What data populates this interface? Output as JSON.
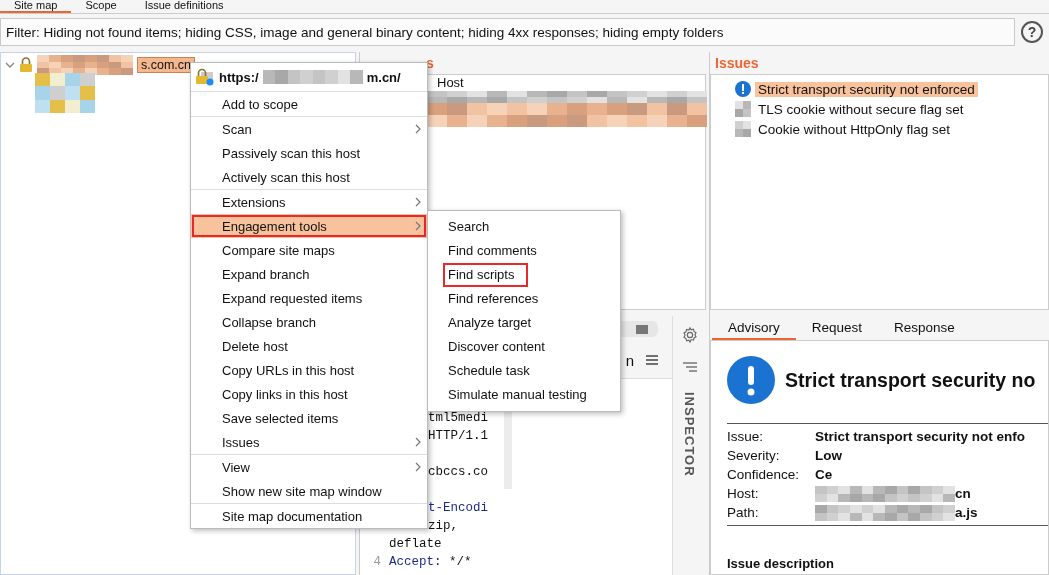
{
  "tabs": [
    {
      "label": "Site map",
      "selected": true
    },
    {
      "label": "Scope",
      "selected": false
    },
    {
      "label": "Issue definitions",
      "selected": false
    }
  ],
  "filter": {
    "text": "Filter: Hiding not found items;  hiding CSS, image and general binary content;  hiding 4xx responses;  hiding empty folders",
    "help": "?"
  },
  "tree": {
    "items": [
      {
        "label": "s.com.cn",
        "selected": true,
        "expanded": true
      }
    ]
  },
  "contents": {
    "title": "s",
    "columns": [
      "Host"
    ]
  },
  "issues": {
    "title": "Issues",
    "items": [
      {
        "label": "Strict transport security not enforced",
        "selected": true
      },
      {
        "label": "TLS cookie without secure flag set",
        "selected": false
      },
      {
        "label": "Cookie without HttpOnly flag set",
        "selected": false
      }
    ]
  },
  "request": {
    "toggle_on": true,
    "fragment": "n",
    "inspector": "INSPECTOR",
    "lines": [
      {
        "kind": "tail",
        "value": "tml5medi"
      },
      {
        "kind": "tail",
        "value": "HTTP/1.1"
      },
      {
        "kind": "tail",
        "gap_before": true,
        "value": "cbccs.co"
      },
      {
        "kind": "tail",
        "gap_before": true,
        "name": "t-Encodi"
      },
      {
        "kind": "tail",
        "value": "zip,"
      },
      {
        "kind": "full",
        "value": "deflate"
      },
      {
        "kind": "full",
        "number": "4",
        "name": "Accept:",
        "value": " */*"
      }
    ]
  },
  "advisory": {
    "tabs": [
      {
        "label": "Advisory",
        "selected": true
      },
      {
        "label": "Request",
        "selected": false
      },
      {
        "label": "Response",
        "selected": false
      }
    ],
    "title": "Strict transport security no",
    "fields": [
      {
        "label": "Issue:",
        "value": "Strict transport security not enfo"
      },
      {
        "label": "Severity:",
        "value": "Low"
      },
      {
        "label": "Confidence:",
        "value": "Ce"
      },
      {
        "label": "Host:",
        "value": "cn"
      },
      {
        "label": "Path:",
        "value": "a.js"
      }
    ],
    "section": "Issue description"
  },
  "context_menu": {
    "header": {
      "start": "https:/",
      "end": "m.cn/"
    },
    "groups": [
      [
        {
          "label": "Add to scope",
          "submenu": false,
          "selected": false,
          "annotated": false
        }
      ],
      [
        {
          "label": "Scan",
          "submenu": true,
          "selected": false,
          "annotated": false
        },
        {
          "label": "Passively scan this host",
          "submenu": false,
          "selected": false,
          "annotated": false
        },
        {
          "label": "Actively scan this host",
          "submenu": false,
          "selected": false,
          "annotated": false
        }
      ],
      [
        {
          "label": "Extensions",
          "submenu": true,
          "selected": false,
          "annotated": false
        },
        {
          "label": "Engagement tools",
          "submenu": true,
          "selected": true,
          "annotated": true
        },
        {
          "label": "Compare site maps",
          "submenu": false,
          "selected": false,
          "annotated": false
        },
        {
          "label": "Expand branch",
          "submenu": false,
          "selected": false,
          "annotated": false
        },
        {
          "label": "Expand requested items",
          "submenu": false,
          "selected": false,
          "annotated": false
        },
        {
          "label": "Collapse branch",
          "submenu": false,
          "selected": false,
          "annotated": false
        },
        {
          "label": "Delete host",
          "submenu": false,
          "selected": false,
          "annotated": false
        },
        {
          "label": "Copy URLs in this host",
          "submenu": false,
          "selected": false,
          "annotated": false
        },
        {
          "label": "Copy links in this host",
          "submenu": false,
          "selected": false,
          "annotated": false
        },
        {
          "label": "Save selected items",
          "submenu": false,
          "selected": false,
          "annotated": false
        },
        {
          "label": "Issues",
          "submenu": true,
          "selected": false,
          "annotated": false
        }
      ],
      [
        {
          "label": "View",
          "submenu": true,
          "selected": false,
          "annotated": false
        },
        {
          "label": "Show new site map window",
          "submenu": false,
          "selected": false,
          "annotated": false
        }
      ],
      [
        {
          "label": "Site map documentation",
          "submenu": false,
          "selected": false,
          "annotated": false
        }
      ]
    ]
  },
  "submenu": {
    "items": [
      {
        "label": "Search",
        "annotated": false
      },
      {
        "label": "Find comments",
        "annotated": false
      },
      {
        "label": "Find scripts",
        "annotated": true
      },
      {
        "label": "Find references",
        "annotated": false
      },
      {
        "label": "Analyze target",
        "annotated": false
      },
      {
        "label": "Discover content",
        "annotated": false
      },
      {
        "label": "Schedule task",
        "annotated": false
      },
      {
        "label": "Simulate manual testing",
        "annotated": false
      }
    ]
  }
}
